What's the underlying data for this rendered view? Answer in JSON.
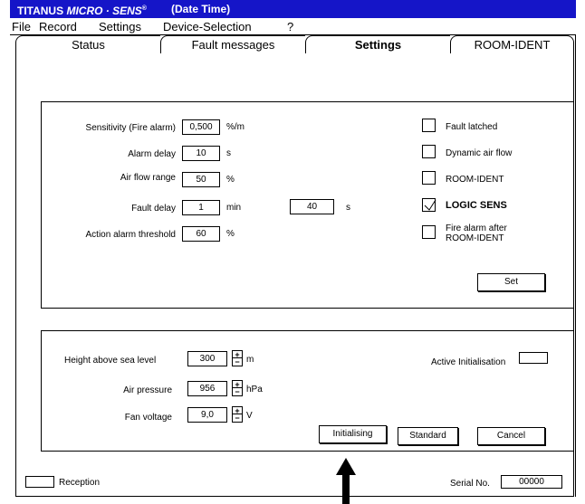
{
  "title": {
    "brand_a": "TITANUS",
    "brand_b": "MICRO · SENS",
    "reg": "®",
    "datetime": "(Date Time)"
  },
  "menu": [
    "File",
    "Record",
    "Settings",
    "Device-Selection",
    "?"
  ],
  "tabs": [
    "Status",
    "Fault messages",
    "Settings",
    "ROOM-IDENT"
  ],
  "active_tab": "Settings",
  "params": {
    "sensitivity": {
      "label": "Sensitivity (Fire alarm)",
      "value": "0,500",
      "unit": "%/m"
    },
    "alarm_delay": {
      "label": "Alarm delay",
      "value": "10",
      "unit": "s"
    },
    "air_flow_range": {
      "label": "Air flow range",
      "value": "50",
      "unit": "%"
    },
    "fault_delay": {
      "label": "Fault delay",
      "value_min": "1",
      "unit_min": "min",
      "value_s": "40",
      "unit_s": "s"
    },
    "action_alarm": {
      "label": "Action alarm threshold",
      "value": "60",
      "unit": "%"
    }
  },
  "checks": [
    {
      "label": "Fault latched",
      "checked": false
    },
    {
      "label": "Dynamic air flow",
      "checked": false
    },
    {
      "label": "ROOM-IDENT",
      "checked": false
    },
    {
      "label": "LOGIC SENS",
      "checked": true
    },
    {
      "label": "Fire alarm after ROOM-IDENT",
      "line1": "Fire alarm after",
      "line2": "ROOM-IDENT",
      "checked": false
    }
  ],
  "set_label": "Set",
  "env": {
    "height": {
      "label": "Height above sea level",
      "value": "300",
      "unit": "m"
    },
    "pressure": {
      "label": "Air pressure",
      "value": "956",
      "unit": "hPa"
    },
    "fan": {
      "label": "Fan voltage",
      "value": "9,0",
      "unit": "V"
    },
    "active_init_label": "Active Initialisation",
    "active_init_value": ""
  },
  "buttons": {
    "initialising": "Initialising",
    "standard": "Standard",
    "cancel": "Cancel"
  },
  "spin": {
    "up": "+",
    "down": "−"
  },
  "footer": {
    "reception_label": "Reception",
    "reception_value": "",
    "serial_label": "Serial No.",
    "serial_value": "00000"
  }
}
